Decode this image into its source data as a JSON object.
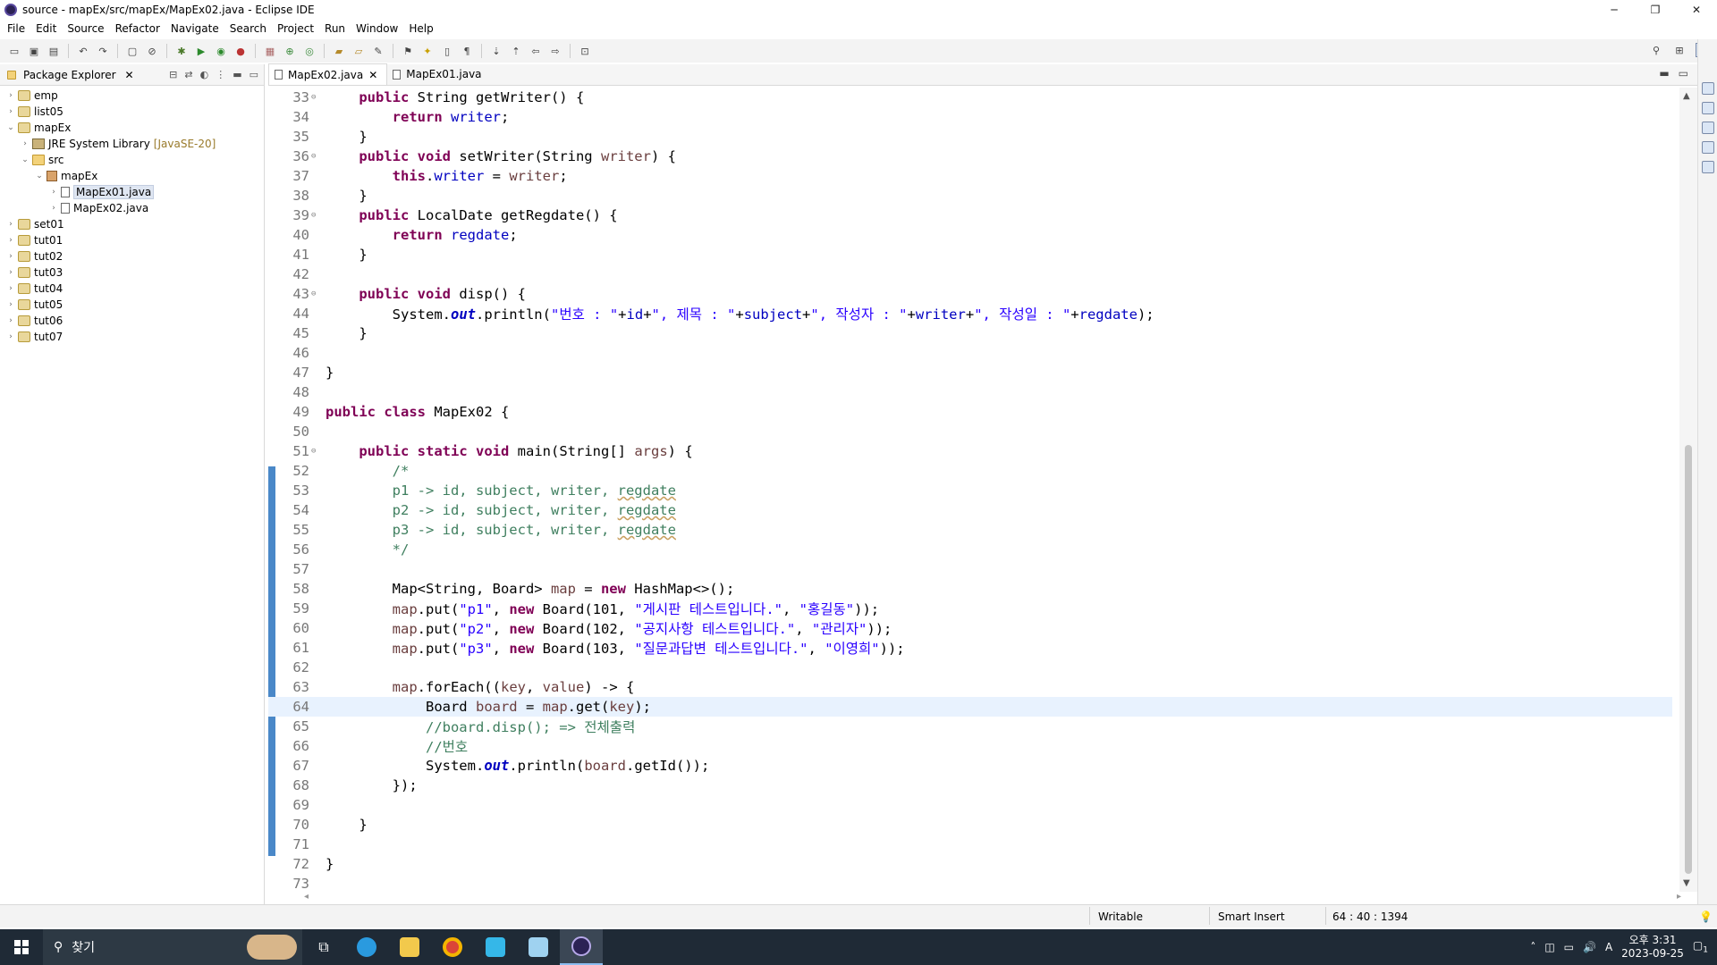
{
  "window": {
    "title": "source - mapEx/src/mapEx/MapEx02.java - Eclipse IDE",
    "controls": [
      "─",
      "❐",
      "✕"
    ]
  },
  "menu": [
    "File",
    "Edit",
    "Source",
    "Refactor",
    "Navigate",
    "Search",
    "Project",
    "Run",
    "Window",
    "Help"
  ],
  "package_explorer": {
    "title": "Package Explorer",
    "items": [
      {
        "label": "emp",
        "type": "project",
        "level": 0,
        "expanded": false
      },
      {
        "label": "list05",
        "type": "project",
        "level": 0,
        "expanded": false
      },
      {
        "label": "mapEx",
        "type": "project",
        "level": 0,
        "expanded": true
      },
      {
        "label": "JRE System Library",
        "suffix": "[JavaSE-20]",
        "type": "library",
        "level": 1,
        "expanded": false
      },
      {
        "label": "src",
        "type": "folder",
        "level": 1,
        "expanded": true
      },
      {
        "label": "mapEx",
        "type": "package",
        "level": 2,
        "expanded": true
      },
      {
        "label": "MapEx01.java",
        "type": "java",
        "level": 3,
        "expanded": false,
        "selected": true
      },
      {
        "label": "MapEx02.java",
        "type": "java",
        "level": 3,
        "expanded": false
      },
      {
        "label": "set01",
        "type": "project",
        "level": 0,
        "expanded": false
      },
      {
        "label": "tut01",
        "type": "project",
        "level": 0,
        "expanded": false
      },
      {
        "label": "tut02",
        "type": "project",
        "level": 0,
        "expanded": false
      },
      {
        "label": "tut03",
        "type": "project",
        "level": 0,
        "expanded": false
      },
      {
        "label": "tut04",
        "type": "project",
        "level": 0,
        "expanded": false
      },
      {
        "label": "tut05",
        "type": "project",
        "level": 0,
        "expanded": false
      },
      {
        "label": "tut06",
        "type": "project",
        "level": 0,
        "expanded": false
      },
      {
        "label": "tut07",
        "type": "project",
        "level": 0,
        "expanded": false
      }
    ]
  },
  "editor": {
    "tabs": [
      {
        "label": "MapEx02.java",
        "active": true
      },
      {
        "label": "MapEx01.java",
        "active": false
      }
    ],
    "current_line": 64,
    "lines": [
      {
        "n": "33",
        "fold": true,
        "t": [
          [
            "    ",
            ""
          ],
          [
            "public",
            "kw"
          ],
          [
            " String getWriter() {",
            ""
          ]
        ]
      },
      {
        "n": "34",
        "t": [
          [
            "        ",
            ""
          ],
          [
            "return",
            "kw"
          ],
          [
            " ",
            ""
          ],
          [
            "writer",
            "fld"
          ],
          [
            ";",
            ""
          ]
        ]
      },
      {
        "n": "35",
        "t": [
          [
            "    }",
            ""
          ]
        ]
      },
      {
        "n": "36",
        "fold": true,
        "t": [
          [
            "    ",
            ""
          ],
          [
            "public",
            "kw"
          ],
          [
            " ",
            ""
          ],
          [
            "void",
            "kw"
          ],
          [
            " setWriter(String ",
            ""
          ],
          [
            "writer",
            "prm"
          ],
          [
            ") {",
            ""
          ]
        ]
      },
      {
        "n": "37",
        "t": [
          [
            "        ",
            ""
          ],
          [
            "this",
            "kw"
          ],
          [
            ".",
            ""
          ],
          [
            "writer",
            "fld"
          ],
          [
            " = ",
            ""
          ],
          [
            "writer",
            "prm"
          ],
          [
            ";",
            ""
          ]
        ]
      },
      {
        "n": "38",
        "t": [
          [
            "    }",
            ""
          ]
        ]
      },
      {
        "n": "39",
        "fold": true,
        "t": [
          [
            "    ",
            ""
          ],
          [
            "public",
            "kw"
          ],
          [
            " LocalDate getRegdate() {",
            ""
          ]
        ]
      },
      {
        "n": "40",
        "t": [
          [
            "        ",
            ""
          ],
          [
            "return",
            "kw"
          ],
          [
            " ",
            ""
          ],
          [
            "regdate",
            "fld"
          ],
          [
            ";",
            ""
          ]
        ]
      },
      {
        "n": "41",
        "t": [
          [
            "    }",
            ""
          ]
        ]
      },
      {
        "n": "42",
        "t": []
      },
      {
        "n": "43",
        "fold": true,
        "t": [
          [
            "    ",
            ""
          ],
          [
            "public",
            "kw"
          ],
          [
            " ",
            ""
          ],
          [
            "void",
            "kw"
          ],
          [
            " disp() {",
            ""
          ]
        ]
      },
      {
        "n": "44",
        "t": [
          [
            "        System.",
            ""
          ],
          [
            "out",
            "sfld"
          ],
          [
            ".println(",
            ""
          ],
          [
            "\"번호 : \"",
            "str"
          ],
          [
            "+",
            ""
          ],
          [
            "id",
            "fld"
          ],
          [
            "+",
            ""
          ],
          [
            "\", 제목 : \"",
            "str"
          ],
          [
            "+",
            ""
          ],
          [
            "subject",
            "fld"
          ],
          [
            "+",
            ""
          ],
          [
            "\", 작성자 : \"",
            "str"
          ],
          [
            "+",
            ""
          ],
          [
            "writer",
            "fld"
          ],
          [
            "+",
            ""
          ],
          [
            "\", 작성일 : \"",
            "str"
          ],
          [
            "+",
            ""
          ],
          [
            "regdate",
            "fld"
          ],
          [
            ");",
            ""
          ]
        ]
      },
      {
        "n": "45",
        "t": [
          [
            "    }",
            ""
          ]
        ]
      },
      {
        "n": "46",
        "t": []
      },
      {
        "n": "47",
        "t": [
          [
            "}",
            ""
          ]
        ]
      },
      {
        "n": "48",
        "t": []
      },
      {
        "n": "49",
        "t": [
          [
            "public",
            "kw"
          ],
          [
            " ",
            ""
          ],
          [
            "class",
            "kw"
          ],
          [
            " MapEx02 {",
            ""
          ]
        ]
      },
      {
        "n": "50",
        "t": []
      },
      {
        "n": "51",
        "fold": true,
        "t": [
          [
            "    ",
            ""
          ],
          [
            "public",
            "kw"
          ],
          [
            " ",
            ""
          ],
          [
            "static",
            "kw"
          ],
          [
            " ",
            ""
          ],
          [
            "void",
            "kw"
          ],
          [
            " main(String[] ",
            ""
          ],
          [
            "args",
            "prm"
          ],
          [
            ") {",
            ""
          ]
        ]
      },
      {
        "n": "52",
        "t": [
          [
            "        /*",
            "cmt"
          ]
        ]
      },
      {
        "n": "53",
        "t": [
          [
            "        p1 -> id, subject, writer, ",
            "cmt"
          ],
          [
            "regdate",
            "cmt squig"
          ]
        ]
      },
      {
        "n": "54",
        "t": [
          [
            "        p2 -> id, subject, writer, ",
            "cmt"
          ],
          [
            "regdate",
            "cmt squig"
          ]
        ]
      },
      {
        "n": "55",
        "t": [
          [
            "        p3 -> id, subject, writer, ",
            "cmt"
          ],
          [
            "regdate",
            "cmt squig"
          ]
        ]
      },
      {
        "n": "56",
        "t": [
          [
            "        */",
            "cmt"
          ]
        ]
      },
      {
        "n": "57",
        "t": []
      },
      {
        "n": "58",
        "t": [
          [
            "        Map<String, Board> ",
            ""
          ],
          [
            "map",
            "prm"
          ],
          [
            " = ",
            ""
          ],
          [
            "new",
            "kw"
          ],
          [
            " HashMap<>();",
            ""
          ]
        ]
      },
      {
        "n": "59",
        "t": [
          [
            "        ",
            ""
          ],
          [
            "map",
            "prm"
          ],
          [
            ".put(",
            ""
          ],
          [
            "\"p1\"",
            "str"
          ],
          [
            ", ",
            ""
          ],
          [
            "new",
            "kw"
          ],
          [
            " Board(101, ",
            ""
          ],
          [
            "\"게시판 테스트입니다.\"",
            "str"
          ],
          [
            ", ",
            ""
          ],
          [
            "\"홍길동\"",
            "str"
          ],
          [
            "));",
            ""
          ]
        ]
      },
      {
        "n": "60",
        "t": [
          [
            "        ",
            ""
          ],
          [
            "map",
            "prm"
          ],
          [
            ".put(",
            ""
          ],
          [
            "\"p2\"",
            "str"
          ],
          [
            ", ",
            ""
          ],
          [
            "new",
            "kw"
          ],
          [
            " Board(102, ",
            ""
          ],
          [
            "\"공지사항 테스트입니다.\"",
            "str"
          ],
          [
            ", ",
            ""
          ],
          [
            "\"관리자\"",
            "str"
          ],
          [
            "));",
            ""
          ]
        ]
      },
      {
        "n": "61",
        "t": [
          [
            "        ",
            ""
          ],
          [
            "map",
            "prm"
          ],
          [
            ".put(",
            ""
          ],
          [
            "\"p3\"",
            "str"
          ],
          [
            ", ",
            ""
          ],
          [
            "new",
            "kw"
          ],
          [
            " Board(103, ",
            ""
          ],
          [
            "\"질문과답변 테스트입니다.\"",
            "str"
          ],
          [
            ", ",
            ""
          ],
          [
            "\"이영희\"",
            "str"
          ],
          [
            "));",
            ""
          ]
        ]
      },
      {
        "n": "62",
        "t": []
      },
      {
        "n": "63",
        "t": [
          [
            "        ",
            ""
          ],
          [
            "map",
            "prm"
          ],
          [
            ".forEach((",
            ""
          ],
          [
            "key",
            "prm"
          ],
          [
            ", ",
            ""
          ],
          [
            "value",
            "prm"
          ],
          [
            ") -> {",
            ""
          ]
        ]
      },
      {
        "n": "64",
        "t": [
          [
            "            Board ",
            ""
          ],
          [
            "board",
            "prm"
          ],
          [
            " = ",
            ""
          ],
          [
            "map",
            "prm"
          ],
          [
            ".get(",
            ""
          ],
          [
            "key",
            "prm"
          ],
          [
            ");",
            ""
          ]
        ]
      },
      {
        "n": "65",
        "t": [
          [
            "            //board.disp(); => 전체출력",
            "cmt"
          ]
        ]
      },
      {
        "n": "66",
        "t": [
          [
            "            //번호",
            "cmt"
          ]
        ]
      },
      {
        "n": "67",
        "t": [
          [
            "            System.",
            ""
          ],
          [
            "out",
            "sfld"
          ],
          [
            ".println(",
            ""
          ],
          [
            "board",
            "prm"
          ],
          [
            ".getId());",
            ""
          ]
        ]
      },
      {
        "n": "68",
        "t": [
          [
            "        });",
            ""
          ]
        ]
      },
      {
        "n": "69",
        "t": []
      },
      {
        "n": "70",
        "t": [
          [
            "    }",
            ""
          ]
        ]
      },
      {
        "n": "71",
        "t": []
      },
      {
        "n": "72",
        "t": [
          [
            "}",
            ""
          ]
        ]
      },
      {
        "n": "73",
        "t": []
      }
    ]
  },
  "status": {
    "writable": "Writable",
    "insert_mode": "Smart Insert",
    "position": "64 : 40 : 1394"
  },
  "taskbar": {
    "search_placeholder": "찾기",
    "time": "오후 3:31",
    "date": "2023-09-25",
    "ime": "A",
    "notification_count": "1"
  },
  "colors": {
    "keyword": "#7f0055",
    "field": "#0000c0",
    "string": "#2a00ff",
    "comment": "#3f7f5f",
    "current_line": "#e8f2fe",
    "taskbar": "#1f2a36"
  }
}
